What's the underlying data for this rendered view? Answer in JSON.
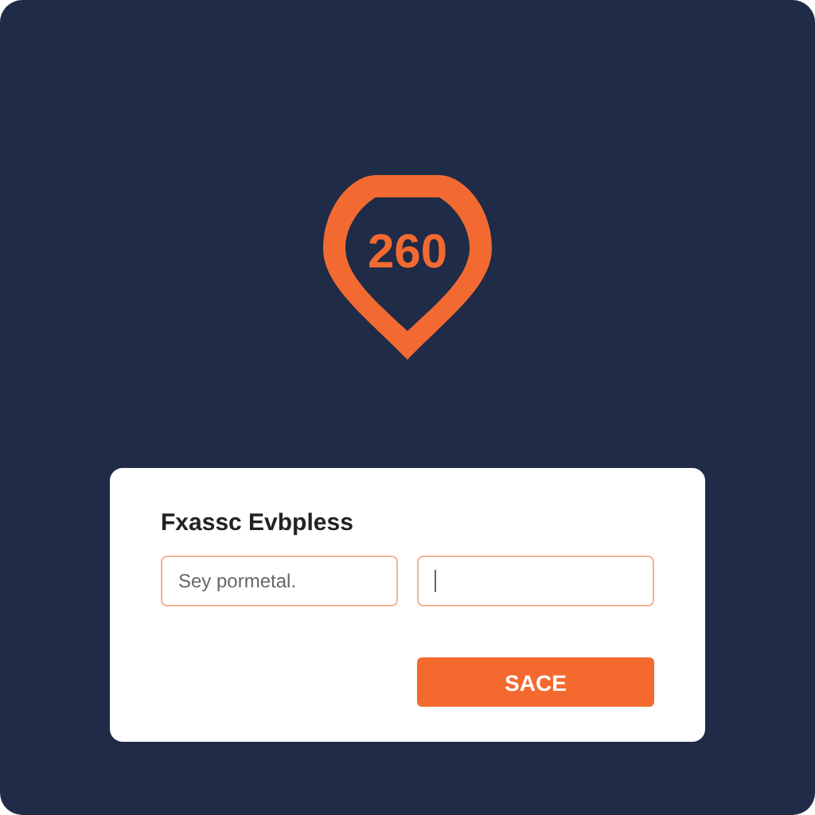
{
  "badge": {
    "value": "260"
  },
  "form": {
    "title": "Fxassc Evbpless",
    "fields": [
      {
        "placeholder": "Sey pormetal.",
        "focused": false
      },
      {
        "focused": true
      }
    ],
    "button": "SACE"
  }
}
